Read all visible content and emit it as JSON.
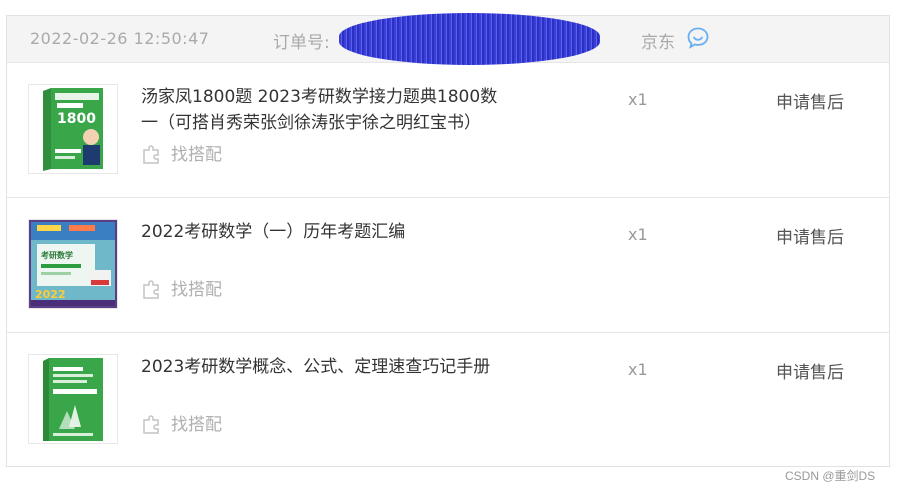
{
  "order": {
    "time": "2022-02-26 12:50:47",
    "order_no_label": "订单号:",
    "shop": "京东",
    "icons": {
      "chat": "chat-bubble-icon",
      "match": "puzzle-icon"
    },
    "colors": {
      "redaction": "#3a3fd6",
      "chat_icon": "#6aaef0",
      "book_green": "#3aa64a"
    },
    "items": [
      {
        "title": "汤家凤1800题 2023考研数学接力题典1800数一（可搭肖秀荣张剑徐涛张宇徐之明红宝书）",
        "match_label": "找搭配",
        "qty": "x1",
        "after_sale": "申请售后",
        "cover_text": [
          "接力题典",
          "1800"
        ]
      },
      {
        "title": "2022考研数学（一）历年考题汇编",
        "match_label": "找搭配",
        "qty": "x1",
        "after_sale": "申请售后",
        "cover_text": [
          "考研数学",
          "2022"
        ]
      },
      {
        "title": "2023考研数学概念、公式、定理速查巧记手册",
        "match_label": "找搭配",
        "qty": "x1",
        "after_sale": "申请售后",
        "cover_text": []
      }
    ]
  },
  "watermark": "CSDN @重剑DS"
}
